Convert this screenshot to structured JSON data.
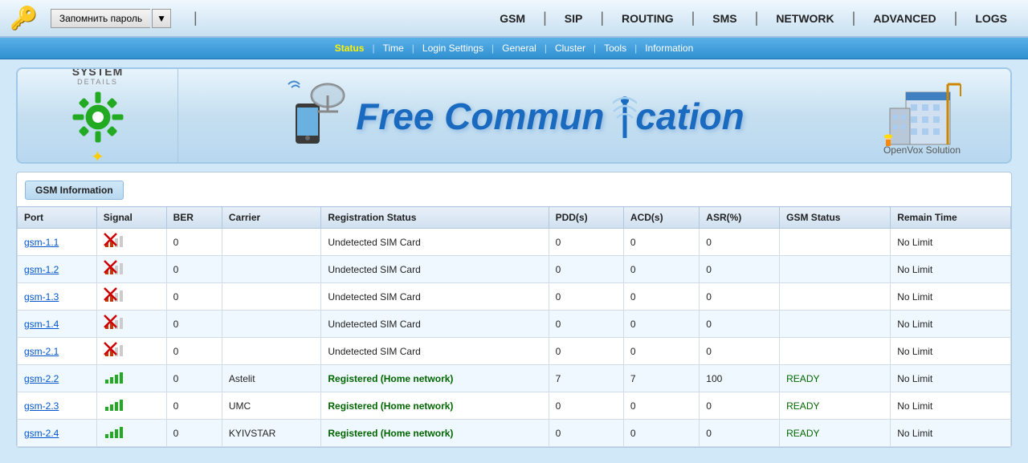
{
  "topbar": {
    "logo": "🔑",
    "remember_password_label": "Запомнить пароль",
    "dropdown_arrow": "▼",
    "nav_items": [
      "GSM",
      "SIP",
      "ROUTING",
      "SMS",
      "NETWORK",
      "ADVANCED",
      "LOGS"
    ]
  },
  "subnav": {
    "items": [
      {
        "label": "Status",
        "active": true
      },
      {
        "label": "Time",
        "active": false
      },
      {
        "label": "Login Settings",
        "active": false
      },
      {
        "label": "General",
        "active": false
      },
      {
        "label": "Cluster",
        "active": false
      },
      {
        "label": "Tools",
        "active": false
      },
      {
        "label": "Information",
        "active": false
      }
    ]
  },
  "banner": {
    "system_label": "SYSTEM",
    "details_label": "DETAILS",
    "free_comm_text": "Free Communication",
    "openvox_label": "OpenVox Solution"
  },
  "gsm_info": {
    "section_title": "GSM Information",
    "columns": [
      "Port",
      "Signal",
      "BER",
      "Carrier",
      "Registration Status",
      "PDD(s)",
      "ACD(s)",
      "ASR(%)",
      "GSM Status",
      "Remain Time"
    ],
    "rows": [
      {
        "port": "gsm-1.1",
        "signal_type": "red",
        "ber": "0",
        "carrier": "",
        "reg_status": "Undetected SIM Card",
        "pdd": "0",
        "acd": "0",
        "asr": "0",
        "gsm_status": "",
        "remain": "No Limit"
      },
      {
        "port": "gsm-1.2",
        "signal_type": "red",
        "ber": "0",
        "carrier": "",
        "reg_status": "Undetected SIM Card",
        "pdd": "0",
        "acd": "0",
        "asr": "0",
        "gsm_status": "",
        "remain": "No Limit"
      },
      {
        "port": "gsm-1.3",
        "signal_type": "red",
        "ber": "0",
        "carrier": "",
        "reg_status": "Undetected SIM Card",
        "pdd": "0",
        "acd": "0",
        "asr": "0",
        "gsm_status": "",
        "remain": "No Limit"
      },
      {
        "port": "gsm-1.4",
        "signal_type": "red",
        "ber": "0",
        "carrier": "",
        "reg_status": "Undetected SIM Card",
        "pdd": "0",
        "acd": "0",
        "asr": "0",
        "gsm_status": "",
        "remain": "No Limit"
      },
      {
        "port": "gsm-2.1",
        "signal_type": "red",
        "ber": "0",
        "carrier": "",
        "reg_status": "Undetected SIM Card",
        "pdd": "0",
        "acd": "0",
        "asr": "0",
        "gsm_status": "",
        "remain": "No Limit"
      },
      {
        "port": "gsm-2.2",
        "signal_type": "green",
        "ber": "0",
        "carrier": "Astelit",
        "reg_status": "Registered (Home network)",
        "pdd": "7",
        "acd": "7",
        "asr": "100",
        "gsm_status": "READY",
        "remain": "No Limit"
      },
      {
        "port": "gsm-2.3",
        "signal_type": "green",
        "ber": "0",
        "carrier": "UMC",
        "reg_status": "Registered (Home network)",
        "pdd": "0",
        "acd": "0",
        "asr": "0",
        "gsm_status": "READY",
        "remain": "No Limit"
      },
      {
        "port": "gsm-2.4",
        "signal_type": "green",
        "ber": "0",
        "carrier": "KYIVSTAR",
        "reg_status": "Registered (Home network)",
        "pdd": "0",
        "acd": "0",
        "asr": "0",
        "gsm_status": "READY",
        "remain": "No Limit"
      }
    ]
  }
}
